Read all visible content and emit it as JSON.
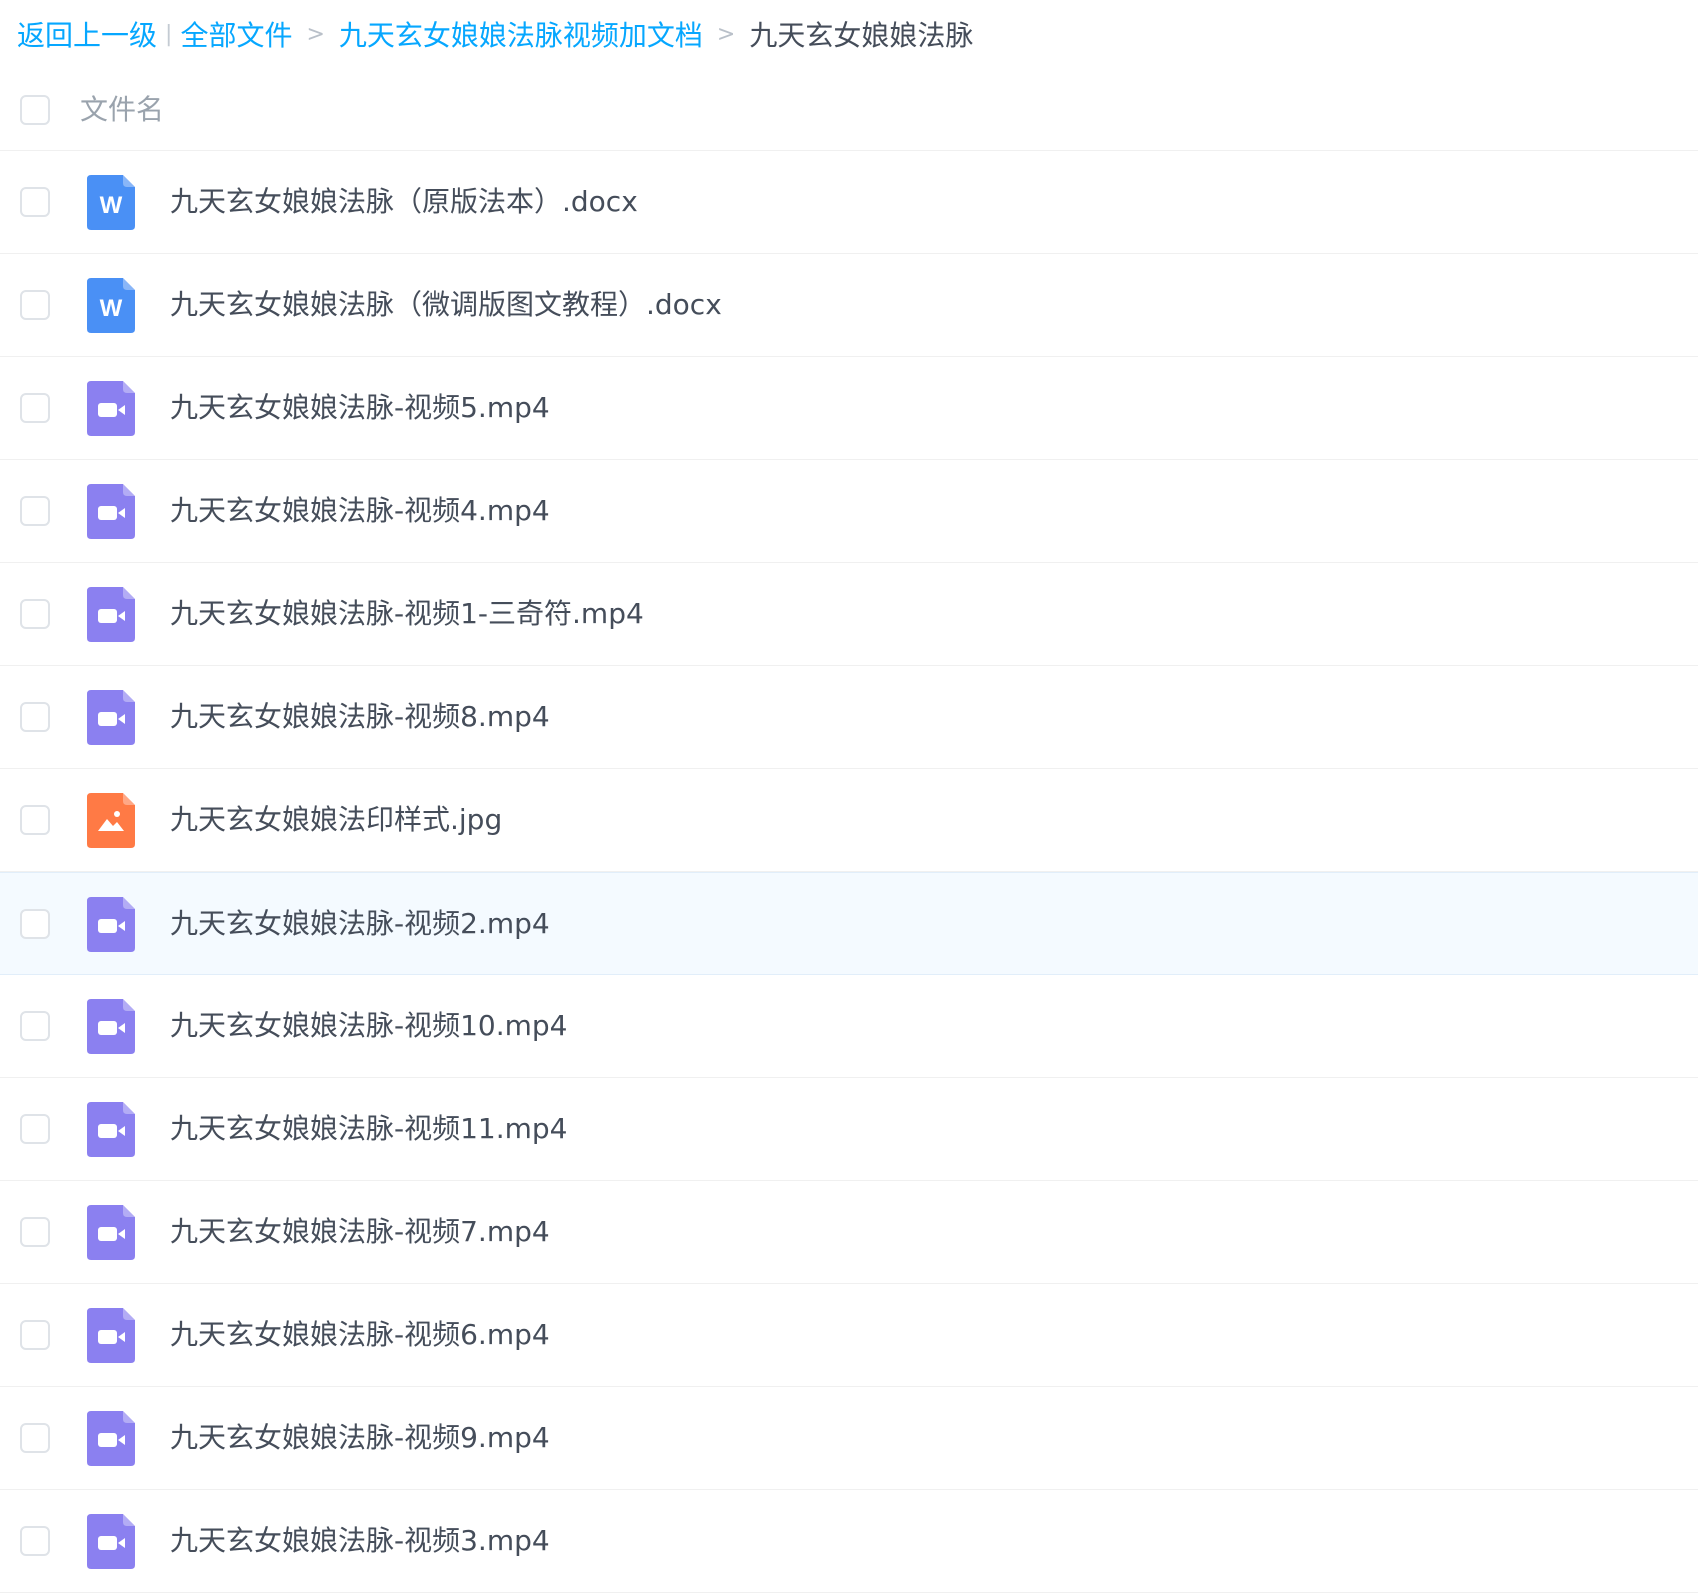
{
  "breadcrumb": {
    "back": "返回上一级",
    "root": "全部文件",
    "folder": "九天玄女娘娘法脉视频加文档",
    "current": "九天玄女娘娘法脉",
    "separator": ">",
    "pipe": "|"
  },
  "header": {
    "name_column": "文件名"
  },
  "colors": {
    "link": "#06a7ff",
    "word": "#4a90f5",
    "video": "#8b80f0",
    "image": "#ff7a45"
  },
  "files": [
    {
      "name": "九天玄女娘娘法脉（原版法本）.docx",
      "type": "word",
      "icon": "word-doc-icon"
    },
    {
      "name": "九天玄女娘娘法脉（微调版图文教程）.docx",
      "type": "word",
      "icon": "word-doc-icon"
    },
    {
      "name": "九天玄女娘娘法脉-视频5.mp4",
      "type": "video",
      "icon": "video-file-icon"
    },
    {
      "name": "九天玄女娘娘法脉-视频4.mp4",
      "type": "video",
      "icon": "video-file-icon"
    },
    {
      "name": "九天玄女娘娘法脉-视频1-三奇符.mp4",
      "type": "video",
      "icon": "video-file-icon"
    },
    {
      "name": "九天玄女娘娘法脉-视频8.mp4",
      "type": "video",
      "icon": "video-file-icon"
    },
    {
      "name": "九天玄女娘娘法印样式.jpg",
      "type": "image",
      "icon": "image-file-icon"
    },
    {
      "name": "九天玄女娘娘法脉-视频2.mp4",
      "type": "video",
      "icon": "video-file-icon",
      "hover": true
    },
    {
      "name": "九天玄女娘娘法脉-视频10.mp4",
      "type": "video",
      "icon": "video-file-icon"
    },
    {
      "name": "九天玄女娘娘法脉-视频11.mp4",
      "type": "video",
      "icon": "video-file-icon"
    },
    {
      "name": "九天玄女娘娘法脉-视频7.mp4",
      "type": "video",
      "icon": "video-file-icon"
    },
    {
      "name": "九天玄女娘娘法脉-视频6.mp4",
      "type": "video",
      "icon": "video-file-icon"
    },
    {
      "name": "九天玄女娘娘法脉-视频9.mp4",
      "type": "video",
      "icon": "video-file-icon"
    },
    {
      "name": "九天玄女娘娘法脉-视频3.mp4",
      "type": "video",
      "icon": "video-file-icon"
    }
  ]
}
